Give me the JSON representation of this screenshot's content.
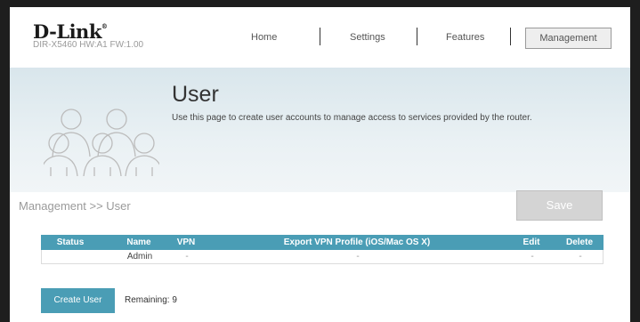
{
  "header": {
    "brand": "D-Link",
    "model_info": "DIR-X5460 HW:A1 FW:1.00",
    "nav": [
      "Home",
      "Settings",
      "Features",
      "Management"
    ],
    "active_nav": "Management"
  },
  "banner": {
    "title": "User",
    "description": "Use this page to create user accounts to manage access to services provided by the router.",
    "icon": "users-icon"
  },
  "breadcrumb": "Management >> User",
  "save_label": "Save",
  "table": {
    "columns": [
      "Status",
      "Name",
      "VPN",
      "Export VPN Profile (iOS/Mac OS X)",
      "Edit",
      "Delete"
    ],
    "rows": [
      {
        "status": "",
        "name": "Admin",
        "vpn": "-",
        "export": "-",
        "edit": "-",
        "delete": "-"
      }
    ]
  },
  "create_user_label": "Create User",
  "remaining_label": "Remaining: 9",
  "colors": {
    "accent": "#4a9db5",
    "save_disabled": "#d4d4d4",
    "banner": "#e2ecf0"
  }
}
